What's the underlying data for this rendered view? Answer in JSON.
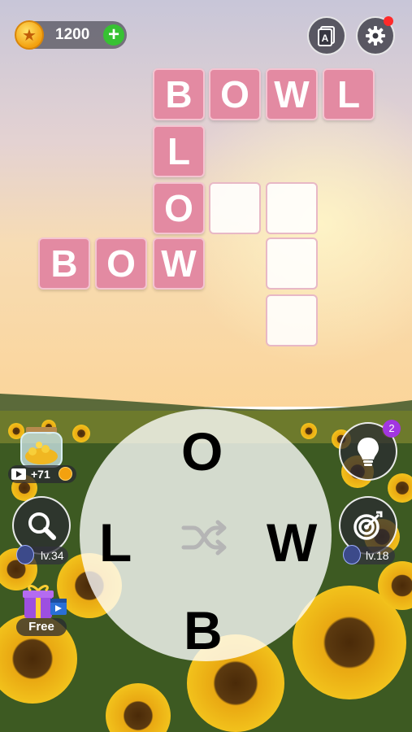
{
  "header": {
    "coin_count": "1200",
    "plus_label": "+",
    "dictionary_icon_letter": "A"
  },
  "board": {
    "words_found": [
      "BOWL",
      "BOW",
      "LOW"
    ],
    "tiles": [
      {
        "letter": "B",
        "filled": true
      },
      {
        "letter": "O",
        "filled": true
      },
      {
        "letter": "W",
        "filled": true
      },
      {
        "letter": "L",
        "filled": true
      },
      {
        "letter": "L",
        "filled": true
      },
      {
        "letter": "O",
        "filled": true
      },
      {
        "letter": "",
        "filled": false
      },
      {
        "letter": "",
        "filled": false
      },
      {
        "letter": "B",
        "filled": true
      },
      {
        "letter": "O",
        "filled": true
      },
      {
        "letter": "W",
        "filled": true
      },
      {
        "letter": "",
        "filled": false
      },
      {
        "letter": "",
        "filled": false
      }
    ]
  },
  "wheel": {
    "letters": {
      "top": "O",
      "left": "L",
      "right": "W",
      "bottom": "B"
    },
    "shuffle_icon": "shuffle-icon"
  },
  "left_panel": {
    "jar_reward": "+71",
    "search_level": "lv.34",
    "gift_label": "Free"
  },
  "right_panel": {
    "hint_count": "2",
    "target_level": "lv.18"
  },
  "colors": {
    "tile_pink": "#e38aa2",
    "tile_empty": "#fafafa",
    "coin_gold": "#f3a10f",
    "plus_green": "#37c233",
    "notification_red": "#ff2a2a",
    "hint_badge_purple": "#a236e0"
  }
}
